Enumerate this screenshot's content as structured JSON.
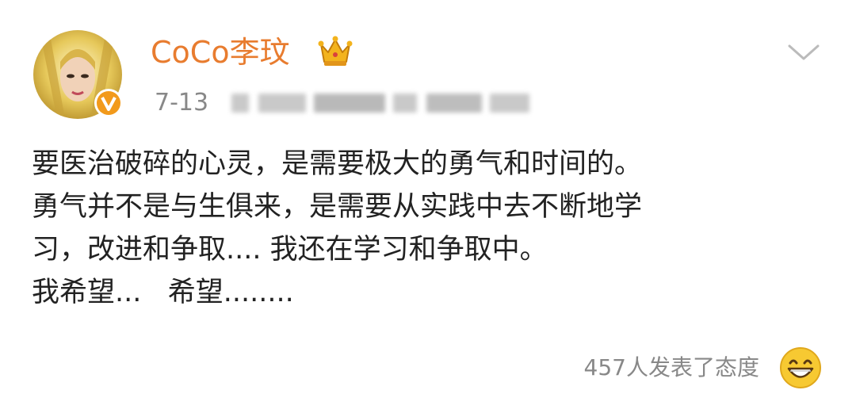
{
  "post": {
    "username": "CoCo李玟",
    "time": "7-13",
    "content_lines": [
      "要医治破碎的心灵，是需要极大的勇气和时间的。",
      "勇气并不是与生俱来，是需要从实践中去不断地学",
      "习，改进和争取.... 我还在学习和争取中。",
      "我希望...   希望........"
    ],
    "reaction_text": "457人发表了态度"
  },
  "icons": {
    "verified": "verified-v-badge-icon",
    "crown": "crown-icon",
    "expand": "chevron-down-icon",
    "reaction": "laughing-emoji-icon"
  },
  "colors": {
    "username": "#e87c2f",
    "verified_badge": "#f29a1b",
    "meta_text": "#888888",
    "body_text": "#222222"
  }
}
